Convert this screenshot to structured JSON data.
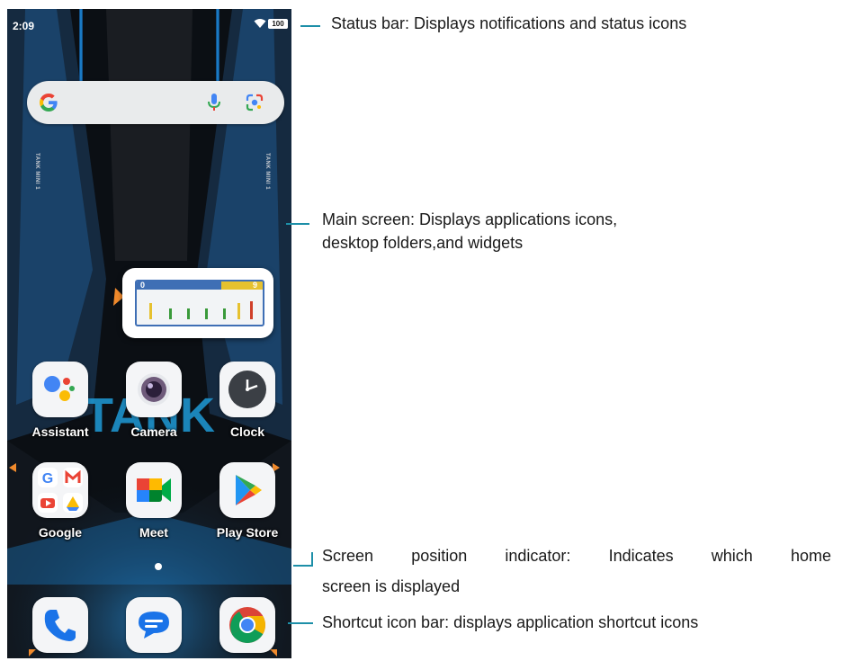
{
  "status_bar": {
    "time": "2:09",
    "battery": "100"
  },
  "search": {
    "logo": "G"
  },
  "side_text": {
    "left": "TANK MINI 1",
    "right": "TANK MINI 1"
  },
  "widget": {
    "gauge_min": "0",
    "gauge_max": "9"
  },
  "wallpaper_text": "TANK",
  "apps": [
    {
      "label": "Assistant",
      "icon": "assistant-icon"
    },
    {
      "label": "Camera",
      "icon": "camera-icon"
    },
    {
      "label": "Clock",
      "icon": "clock-icon"
    },
    {
      "label": "Google",
      "icon": "google-folder-icon"
    },
    {
      "label": "Meet",
      "icon": "meet-icon"
    },
    {
      "label": "Play Store",
      "icon": "play-store-icon"
    }
  ],
  "dock": [
    {
      "icon": "phone-icon"
    },
    {
      "icon": "messages-icon"
    },
    {
      "icon": "chrome-icon"
    }
  ],
  "annotations": {
    "status_bar": "Status bar: Displays notifications and status icons",
    "main_screen_line1": "Main screen: Displays applications icons,",
    "main_screen_line2": "desktop folders,and widgets",
    "indicator_line1": "Screen position indicator: Indicates which home",
    "indicator_line2": "screen is displayed",
    "shortcut": "Shortcut icon bar: displays application shortcut icons"
  },
  "colors": {
    "leader": "#1d8fa8",
    "wallpaper": "#0b0f14",
    "accent_blue": "#1e9ad6"
  }
}
